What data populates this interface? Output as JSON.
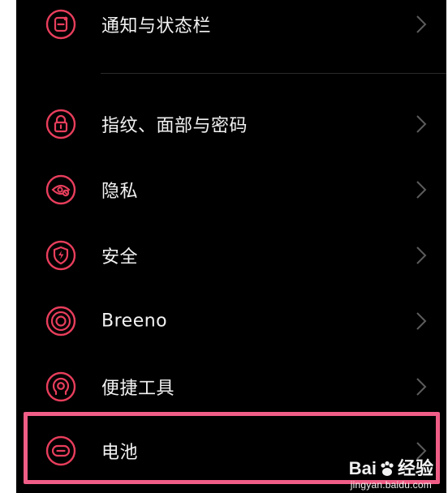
{
  "accent_color": "#e83e5c",
  "highlight_color": "#f05d86",
  "settings": {
    "items": [
      {
        "label": "通知与状态栏",
        "icon": "notification-icon"
      },
      {
        "label": "指纹、面部与密码",
        "icon": "lock-icon"
      },
      {
        "label": "隐私",
        "icon": "privacy-eye-icon"
      },
      {
        "label": "安全",
        "icon": "shield-icon"
      },
      {
        "label": "Breeno",
        "icon": "breeno-icon"
      },
      {
        "label": "便捷工具",
        "icon": "tools-icon"
      },
      {
        "label": "电池",
        "icon": "battery-icon"
      }
    ]
  },
  "watermark": {
    "main_left": "Bai",
    "main_right": "经验",
    "sub": "jingyan.baidu.com"
  }
}
